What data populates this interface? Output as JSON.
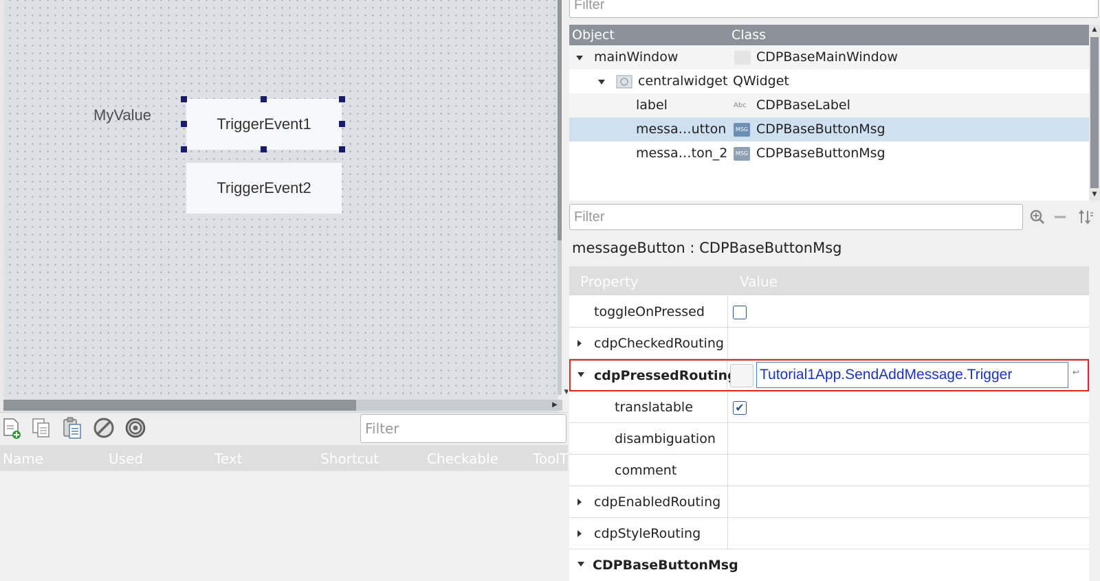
{
  "canvas": {
    "label_text": "MyValue",
    "button1_text": "TriggerEvent1",
    "button2_text": "TriggerEvent2"
  },
  "action_editor": {
    "filter_placeholder": "Filter",
    "columns": [
      "Name",
      "Used",
      "Text",
      "Shortcut",
      "Checkable",
      "ToolT"
    ],
    "toolbar_icons": [
      "new-action-icon",
      "copy-icon",
      "paste-icon",
      "delete-icon",
      "configure-icon"
    ]
  },
  "object_inspector": {
    "filter_placeholder": "Filter",
    "columns": [
      "Object",
      "Class"
    ],
    "rows": [
      {
        "name": "mainWindow",
        "class": "CDPBaseMainWindow"
      },
      {
        "name": "centralwidget",
        "class": "QWidget"
      },
      {
        "name": "label",
        "class": "CDPBaseLabel"
      },
      {
        "name": "messa…utton",
        "class": "CDPBaseButtonMsg"
      },
      {
        "name": "messa…ton_2",
        "class": "CDPBaseButtonMsg"
      }
    ]
  },
  "property_editor": {
    "filter_placeholder": "Filter",
    "object_title": "messageButton : CDPBaseButtonMsg",
    "columns": [
      "Property",
      "Value"
    ],
    "rows": [
      {
        "name": "toggleOnPressed",
        "checked": false
      },
      {
        "name": "cdpCheckedRouting"
      },
      {
        "name": "cdpPressedRouting",
        "value": "Tutorial1App.SendAddMessage.Trigger"
      },
      {
        "name": "translatable",
        "checked": true
      },
      {
        "name": "disambiguation"
      },
      {
        "name": "comment"
      },
      {
        "name": "cdpEnabledRouting"
      },
      {
        "name": "cdpStyleRouting"
      },
      {
        "name": "CDPBaseButtonMsg"
      }
    ]
  },
  "colors": {
    "selection_row": "#cfe0f0",
    "highlight_border": "#e2231a",
    "route_text": "#1a33c9"
  }
}
